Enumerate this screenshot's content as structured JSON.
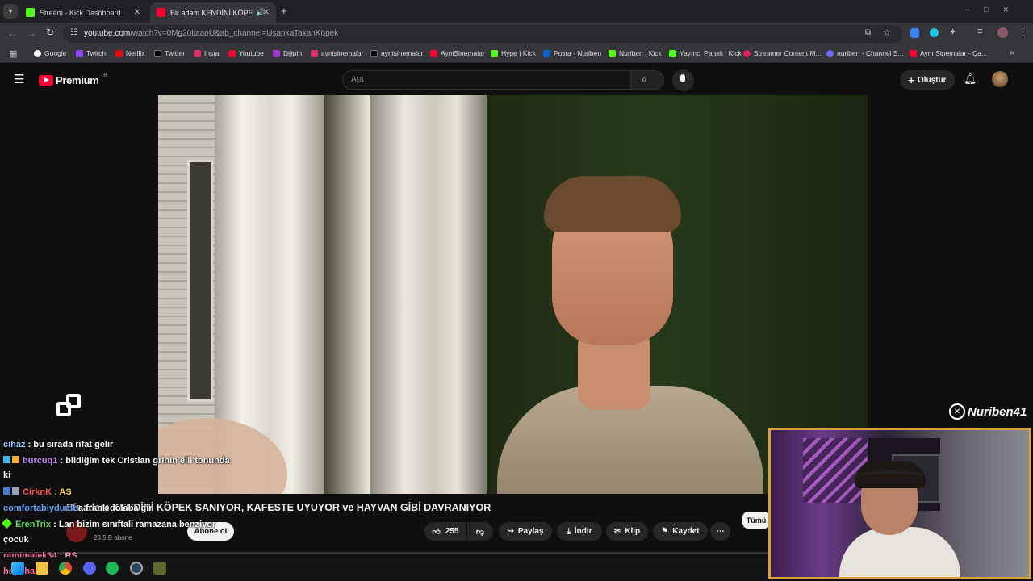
{
  "browser": {
    "tabs": [
      {
        "title": "Stream - Kick Dashboard",
        "active": false
      },
      {
        "title": "Bir adam KENDİNİ KÖPEK S",
        "active": true
      }
    ],
    "new_tab": "+",
    "url_domain": "youtube.com",
    "url_path": "/watch?v=0Mg20tlaaoU&ab_channel=UşankaTakanKöpek",
    "bookmarks": [
      "Google",
      "Twitch",
      "Netflix",
      "Twitter",
      "Insta",
      "Youtube",
      "Dijipin",
      "aynisinemalar",
      "aynisinemalar",
      "AyniSinemalar",
      "Hype | Kick",
      "Posta - Nuriben",
      "Nuriben | Kick",
      "Yayıncı Paneli | Kick",
      "Streamer Content M...",
      "nuriben - Channel S...",
      "Aynı Sinemalar - Ça..."
    ]
  },
  "youtube": {
    "logo_text": "Premium",
    "logo_badge": "TR",
    "search_placeholder": "Ara",
    "create_label": "Oluştur",
    "video_title": "Bir adam KENDİNİ KÖPEK SANIYOR, KAFESTE UYUYOR ve HAYVAN GİBİ DAVRANIYOR",
    "subscribers": "23,5 B abone",
    "subscribe_label": "Abone ol",
    "like_count": "255",
    "share_label": "Paylaş",
    "download_label": "İndir",
    "clip_label": "Klip",
    "save_label": "Kaydet",
    "more_label": "⋯",
    "all_label": "Tümü"
  },
  "overlay": {
    "watermark": "Nuriben41",
    "chat": [
      {
        "user": "cihaz",
        "text": ": bu sırada rıfat gelir",
        "color": "#9ac7ff"
      },
      {
        "user": "burcuq1",
        "text": ": bildiğim tek Cristian grinin elli tonunda",
        "color": "#c58bff"
      },
      {
        "user": "",
        "text": "ki",
        "color": "#ffffff"
      },
      {
        "user": "CirknK",
        "text": ": AS",
        "color": "#ff5b5b"
      },
      {
        "user": "comfortablydumb",
        "text": "a frank dolaba gir",
        "color": "#6aa8ff"
      },
      {
        "user": "ErenTrix",
        "text": ": Lan bizim sınıftali ramazana benziyor",
        "color": "#5fe06a"
      },
      {
        "user": "",
        "text": "çocuk",
        "color": "#ffffff"
      },
      {
        "user": "ramimalek34",
        "text": ": RS",
        "color": "#ff6f9a"
      },
      {
        "user": "hayirhan",
        "text": "",
        "color": "#ff6f9a"
      }
    ]
  },
  "colors": {
    "accent_red": "#ff0033",
    "cam_border": "#d8a33a",
    "kick_green": "#53fc18"
  }
}
